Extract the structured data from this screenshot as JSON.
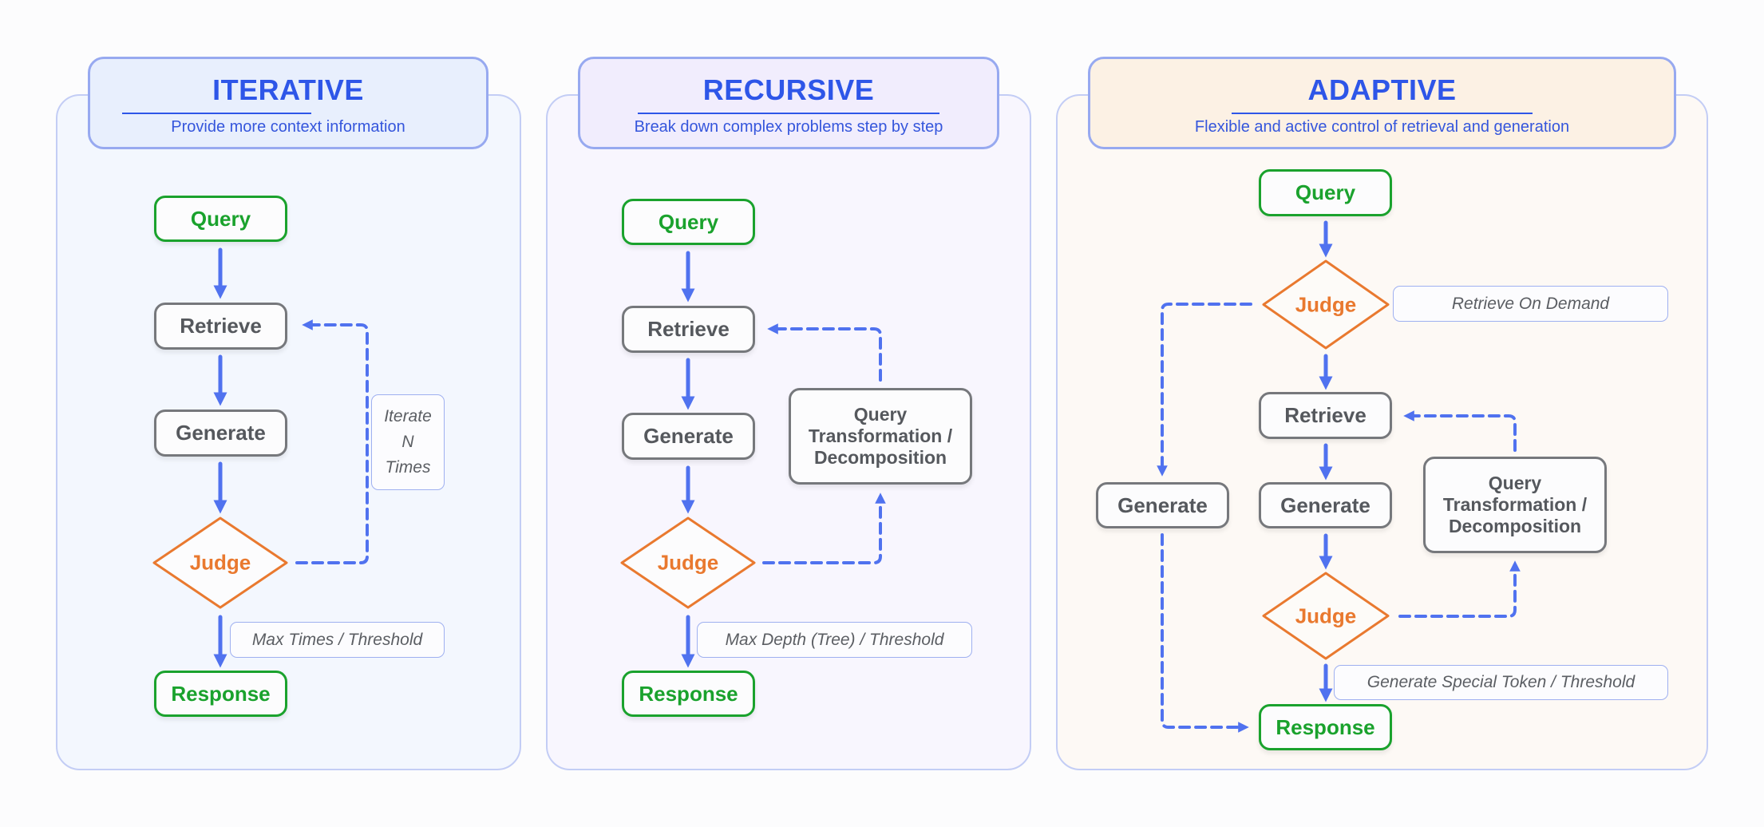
{
  "colors": {
    "accent_blue": "#2e56e8",
    "arrow_blue": "#5072ef",
    "start_end_green": "#1aa22d",
    "judge_orange": "#e9792f",
    "process_gray": "#76787c"
  },
  "panels": {
    "iterative": {
      "title": "ITERATIVE",
      "subtitle": "Provide more context information",
      "nodes": {
        "query": "Query",
        "retrieve": "Retrieve",
        "generate": "Generate",
        "judge": "Judge",
        "response": "Response"
      },
      "notes": {
        "loop": [
          "Iterate",
          "N",
          "Times"
        ],
        "stop": "Max Times / Threshold"
      }
    },
    "recursive": {
      "title": "RECURSIVE",
      "subtitle": "Break down complex problems step by step",
      "nodes": {
        "query": "Query",
        "retrieve": "Retrieve",
        "generate": "Generate",
        "judge": "Judge",
        "response": "Response",
        "transform": [
          "Query",
          "Transformation /",
          "Decomposition"
        ]
      },
      "notes": {
        "stop": "Max Depth (Tree) / Threshold"
      }
    },
    "adaptive": {
      "title": "ADAPTIVE",
      "subtitle": "Flexible and  active control of retrieval and generation",
      "nodes": {
        "query": "Query",
        "judge_top": "Judge",
        "retrieve": "Retrieve",
        "generate_direct": "Generate",
        "generate": "Generate",
        "judge_bottom": "Judge",
        "response": "Response",
        "transform": [
          "Query",
          "Transformation /",
          "Decomposition"
        ]
      },
      "notes": {
        "on_demand": "Retrieve On  Demand",
        "stop": "Generate Special Token / Threshold"
      }
    }
  }
}
